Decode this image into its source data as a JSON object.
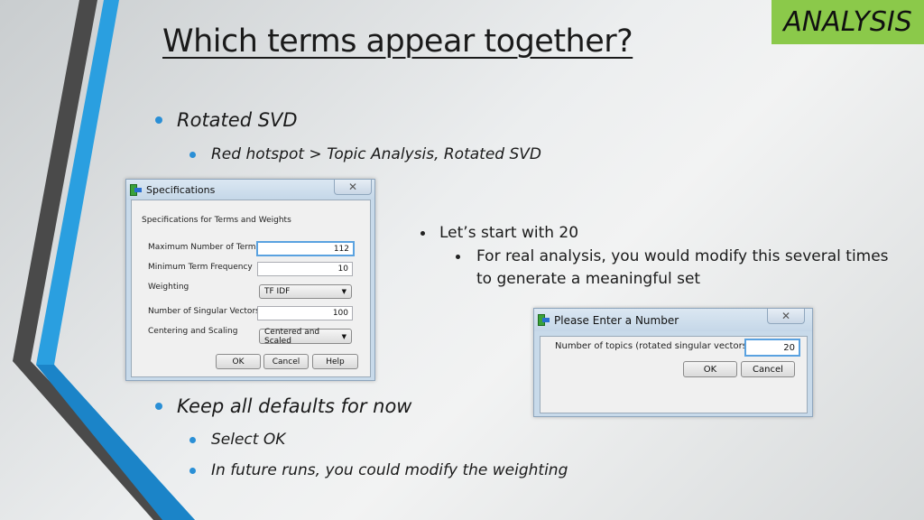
{
  "slide": {
    "section_tag": "ANALYSIS",
    "title": "Which terms appear together?",
    "bullets_top": [
      {
        "text": "Rotated SVD",
        "level": 1
      },
      {
        "text": "Red hotspot > Topic Analysis, Rotated SVD",
        "level": 2
      }
    ],
    "bullets_right": [
      {
        "text": "Let’s start with 20",
        "level": 1
      },
      {
        "text": "For real analysis, you would modify this several times",
        "level": 2
      },
      {
        "text": "to generate a meaningful set",
        "level": 2
      }
    ],
    "bullets_bottom": [
      {
        "text": "Keep all defaults for now",
        "level": 1
      },
      {
        "text": "Select OK",
        "level": 2
      },
      {
        "text": "In future runs, you could modify the weighting",
        "level": 2
      }
    ],
    "accent_colors": {
      "tag": "#8bc94a",
      "bullet": "#2a8fd6",
      "stripe_blue": "#2a9fe0",
      "stripe_gray": "#4a4a4a"
    }
  },
  "spec_dialog": {
    "title": "Specifications",
    "close_glyph": "✕",
    "heading": "Specifications for Terms and Weights",
    "fields": {
      "max_terms": {
        "label": "Maximum Number of Terms",
        "value": "112"
      },
      "min_freq": {
        "label": "Minimum Term Frequency",
        "value": "10"
      },
      "weighting": {
        "label": "Weighting",
        "value": "TF IDF"
      },
      "singular_vectors": {
        "label": "Number of Singular Vectors",
        "value": "100"
      },
      "centering": {
        "label": "Centering and Scaling",
        "value": "Centered and Scaled"
      }
    },
    "buttons": {
      "ok": "OK",
      "cancel": "Cancel",
      "help": "Help"
    }
  },
  "number_dialog": {
    "title": "Please Enter a Number",
    "close_glyph": "✕",
    "prompt": "Number of topics (rotated singular vectors)",
    "value": "20",
    "buttons": {
      "ok": "OK",
      "cancel": "Cancel"
    }
  }
}
